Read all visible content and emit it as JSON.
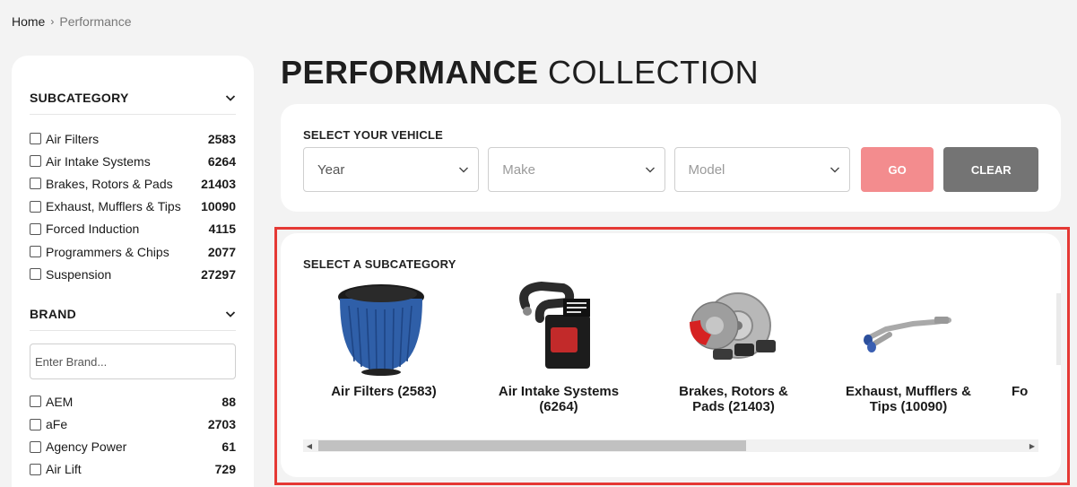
{
  "breadcrumb": {
    "home": "Home",
    "separator": "›",
    "current": "Performance"
  },
  "page_title": {
    "bold": "PERFORMANCE",
    "light": "COLLECTION"
  },
  "sidebar": {
    "subcategory_heading": "SUBCATEGORY",
    "subcategories": [
      {
        "label": "Air Filters",
        "count": "2583"
      },
      {
        "label": "Air Intake Systems",
        "count": "6264"
      },
      {
        "label": "Brakes, Rotors & Pads",
        "count": "21403"
      },
      {
        "label": "Exhaust, Mufflers & Tips",
        "count": "10090"
      },
      {
        "label": "Forced Induction",
        "count": "4115"
      },
      {
        "label": "Programmers & Chips",
        "count": "2077"
      },
      {
        "label": "Suspension",
        "count": "27297"
      }
    ],
    "brand_heading": "BRAND",
    "brand_placeholder": "Enter Brand...",
    "brands": [
      {
        "label": "AEM",
        "count": "88"
      },
      {
        "label": "aFe",
        "count": "2703"
      },
      {
        "label": "Agency Power",
        "count": "61"
      },
      {
        "label": "Air Lift",
        "count": "729"
      }
    ]
  },
  "vehicle_select": {
    "label": "SELECT YOUR VEHICLE",
    "year": "Year",
    "make": "Make",
    "model": "Model",
    "go": "GO",
    "clear": "CLEAR"
  },
  "subcategory_panel": {
    "label": "SELECT A SUBCATEGORY",
    "tiles": [
      {
        "name": "Air Filters (2583)",
        "icon": "air-filter-image"
      },
      {
        "name": "Air Intake Systems (6264)",
        "icon": "air-intake-image"
      },
      {
        "name": "Brakes, Rotors & Pads (21403)",
        "icon": "brakes-image"
      },
      {
        "name": "Exhaust, Mufflers & Tips (10090)",
        "icon": "exhaust-image"
      },
      {
        "name": "Fo",
        "icon": "forced-induction-image"
      }
    ]
  },
  "colors": {
    "go_button": "#f38c8e",
    "clear_button": "#747474",
    "highlight": "#e53935",
    "filter_blue": "#2f5fa8",
    "brake_red": "#d62222"
  }
}
